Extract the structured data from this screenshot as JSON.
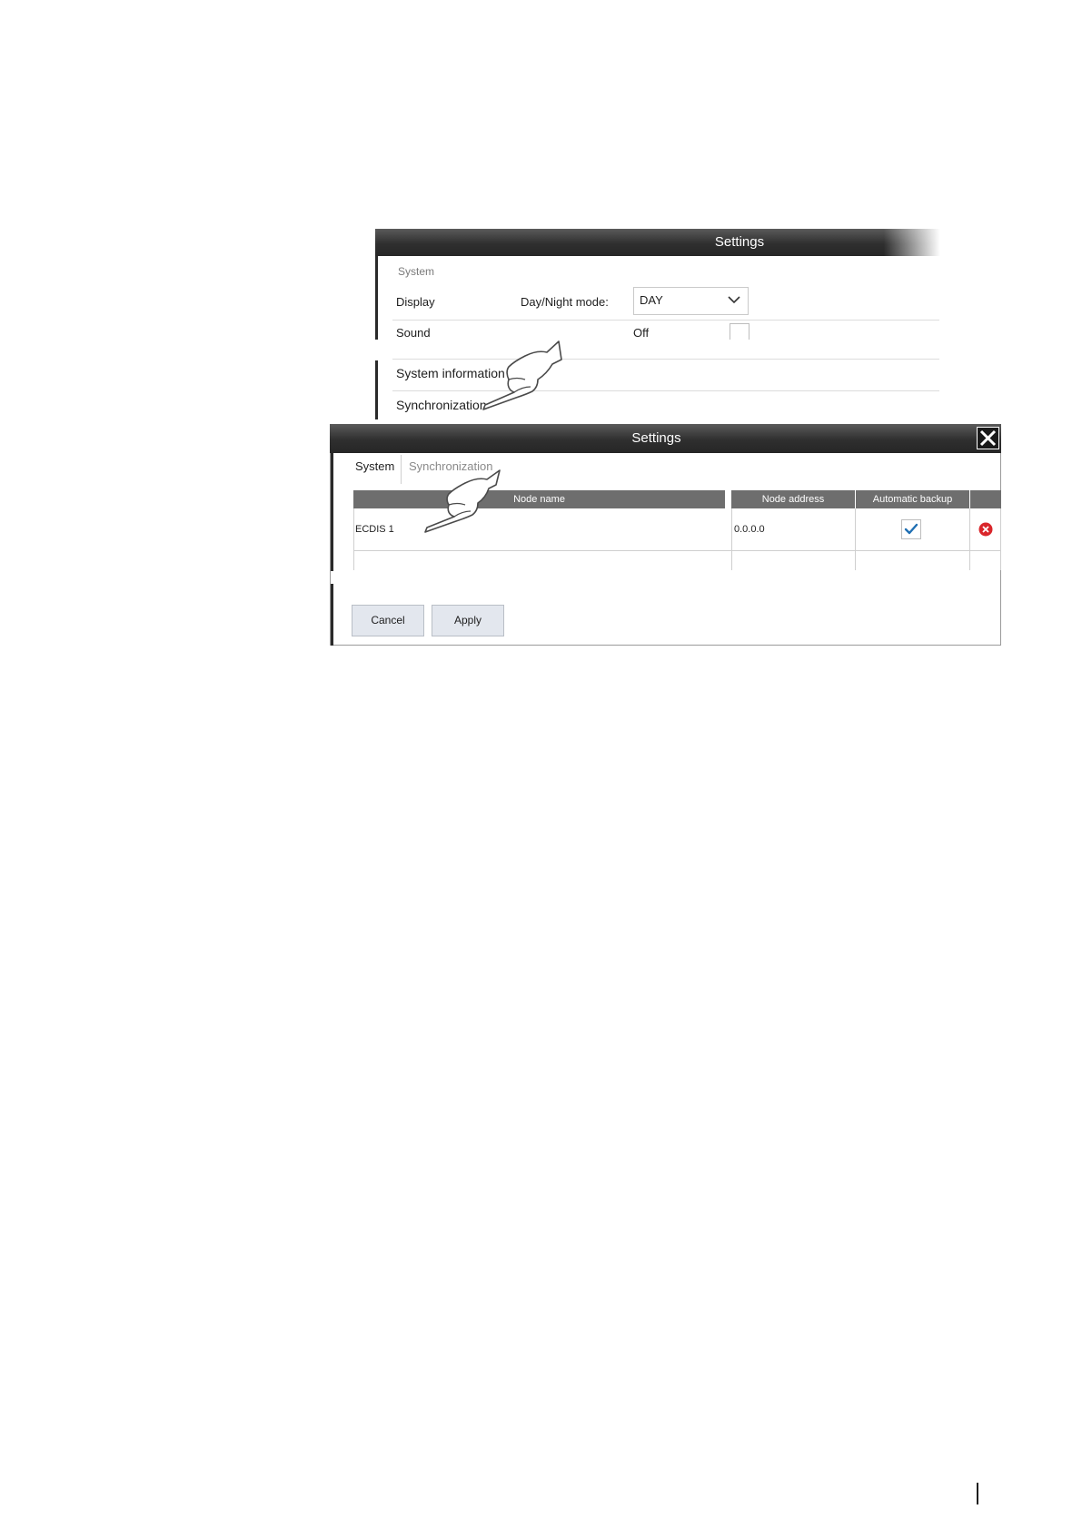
{
  "back_panel": {
    "title": "Settings",
    "section_label": "System",
    "rows": {
      "display_label": "Display",
      "day_night_label": "Day/Night mode:",
      "day_night_value": "DAY",
      "sound_label": "Sound",
      "sound_value": "Off",
      "system_information_label": "System information",
      "synchronization_label": "Synchronization"
    }
  },
  "front_dialog": {
    "title": "Settings",
    "tabs": [
      {
        "label": "System",
        "active": true
      },
      {
        "label": "Synchronization",
        "active": false
      }
    ],
    "table": {
      "columns": [
        "Node name",
        "Node address",
        "Automatic backup",
        ""
      ],
      "rows": [
        {
          "node_name": "ECDIS 1",
          "node_address": "0.0.0.0",
          "automatic_backup": true
        }
      ]
    },
    "buttons": {
      "cancel": "Cancel",
      "apply": "Apply"
    }
  },
  "colors": {
    "titlebar": "#2f2f2f",
    "header": "#6e6e6e",
    "check": "#1f6fb3",
    "delete": "#d9262b",
    "button_bg": "#e3e7ee"
  }
}
